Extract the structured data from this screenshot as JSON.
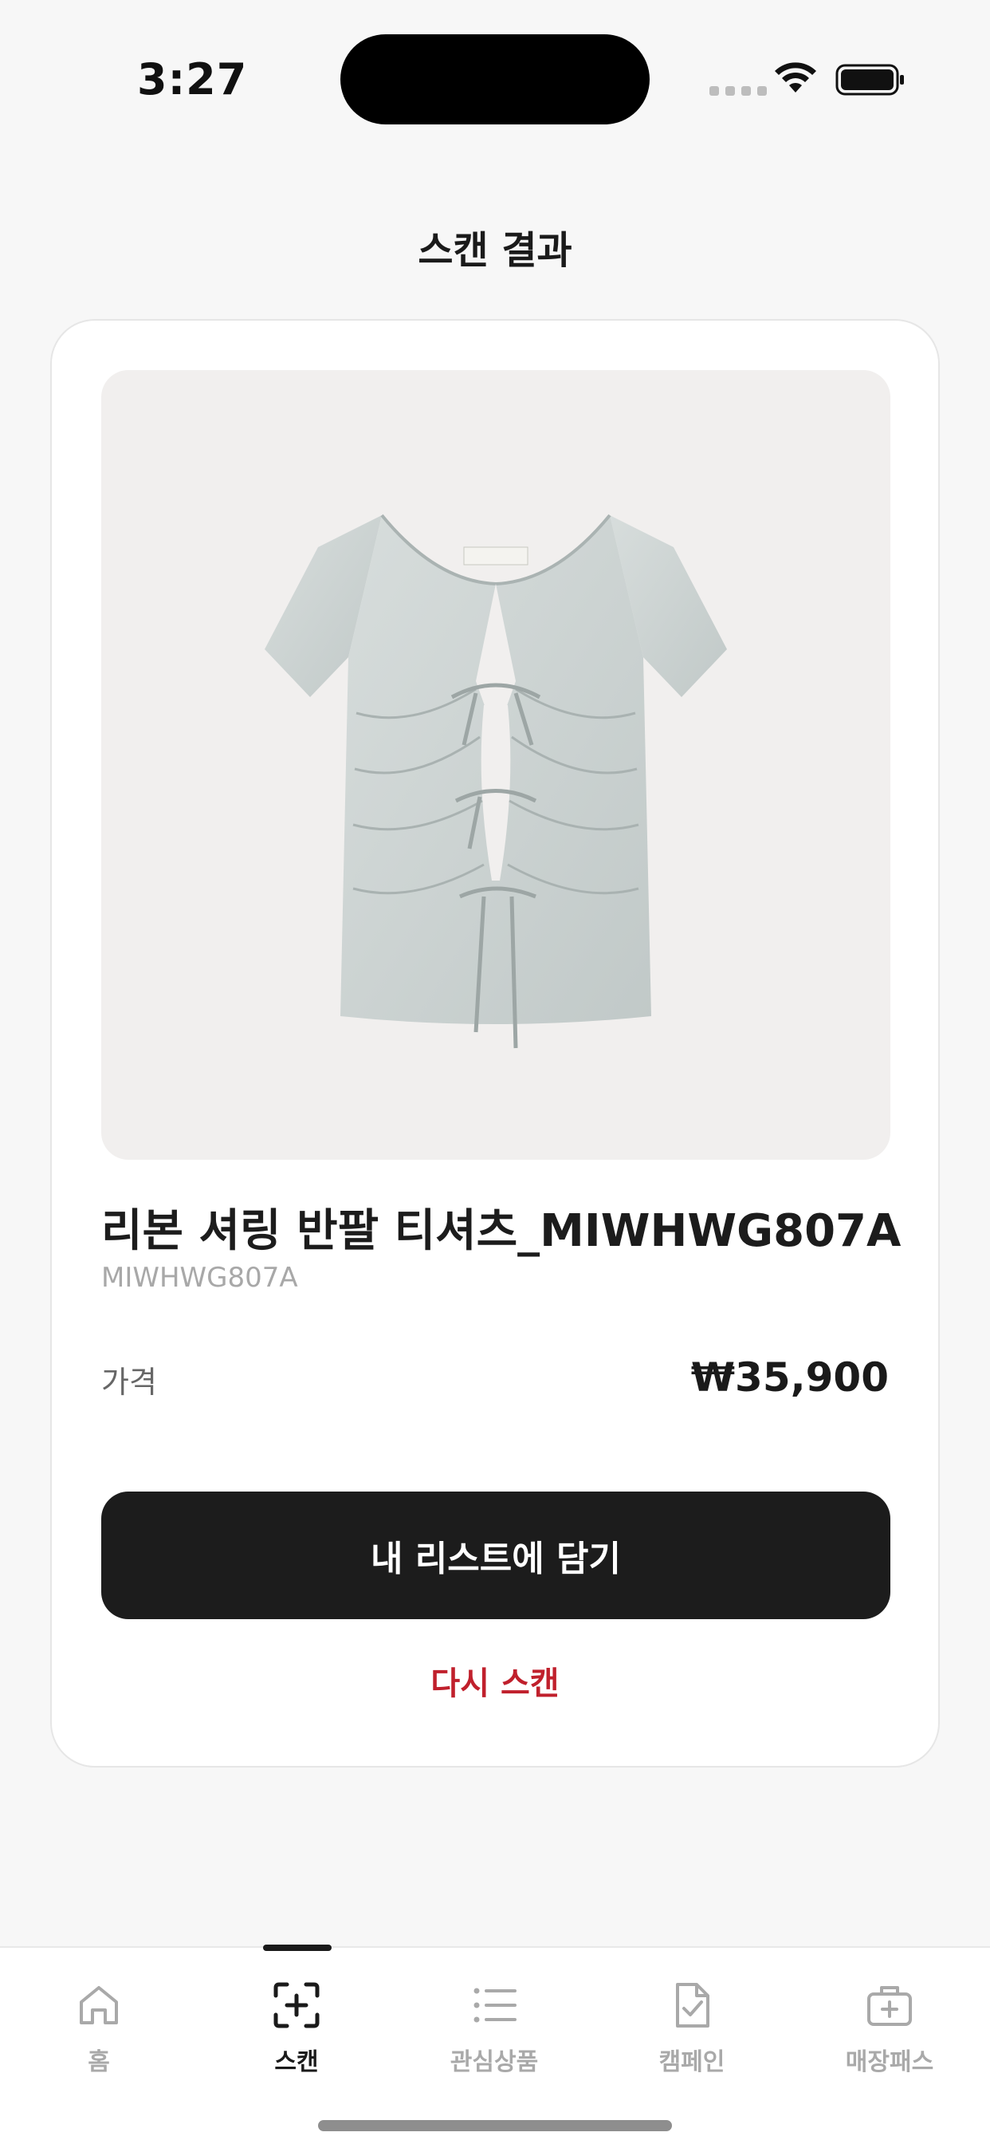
{
  "status_bar": {
    "time": "3:27"
  },
  "header": {
    "title": "스캔 결과"
  },
  "product": {
    "name": "리본 셔링 반팔 티셔츠_MIWHWG807A",
    "code": "MIWHWG807A",
    "price_label": "가격",
    "price": "₩35,900"
  },
  "actions": {
    "add_label": "내 리스트에 담기",
    "rescan_label": "다시 스캔"
  },
  "tabs": [
    {
      "label": "홈",
      "icon": "home-icon",
      "active": false
    },
    {
      "label": "스캔",
      "icon": "scan-icon",
      "active": true
    },
    {
      "label": "관심상품",
      "icon": "list-icon",
      "active": false
    },
    {
      "label": "캠페인",
      "icon": "document-check-icon",
      "active": false
    },
    {
      "label": "매장패스",
      "icon": "briefcase-plus-icon",
      "active": false
    }
  ],
  "colors": {
    "accent": "#c0202c",
    "button": "#1c1c1c",
    "background": "#f7f7f7"
  }
}
